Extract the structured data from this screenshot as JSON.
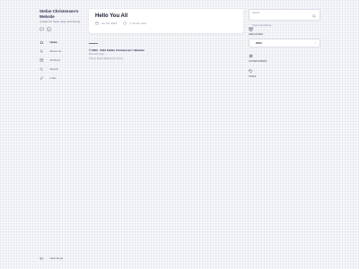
{
  "site": {
    "title": "Stefan Christensen's Website",
    "tagline": "A place for fresh, deep and boring"
  },
  "social": [
    {
      "icon": "comment-icon",
      "name": "social-comment-icon"
    },
    {
      "icon": "rss-icon",
      "name": "social-rss-icon"
    }
  ],
  "nav": [
    {
      "label": "Home",
      "icon": "home-icon",
      "active": true
    },
    {
      "label": "About me",
      "icon": "user-icon",
      "active": false
    },
    {
      "label": "Archives",
      "icon": "archive-icon",
      "active": false
    },
    {
      "label": "Search",
      "icon": "search-icon",
      "active": false
    },
    {
      "label": "Links",
      "icon": "link-icon",
      "active": false
    }
  ],
  "dark_mode": {
    "label": "Dark Mode"
  },
  "post": {
    "title": "Hello You All",
    "date": "Jun 24, 2024",
    "reading_time": "1 minute read"
  },
  "footer": {
    "copyright": "© 2020 - 2024 Stefan Christensen's Website",
    "line2": "Built with Hugo",
    "line3": "Theme Stack designed by Jimmy"
  },
  "search": {
    "label": "Search",
    "placeholder": "Type something..."
  },
  "archives": {
    "label": "ARCHIVES",
    "year": "2024"
  },
  "categories": {
    "label": "CATEGORIES"
  },
  "tags": {
    "label": "TAGS"
  }
}
